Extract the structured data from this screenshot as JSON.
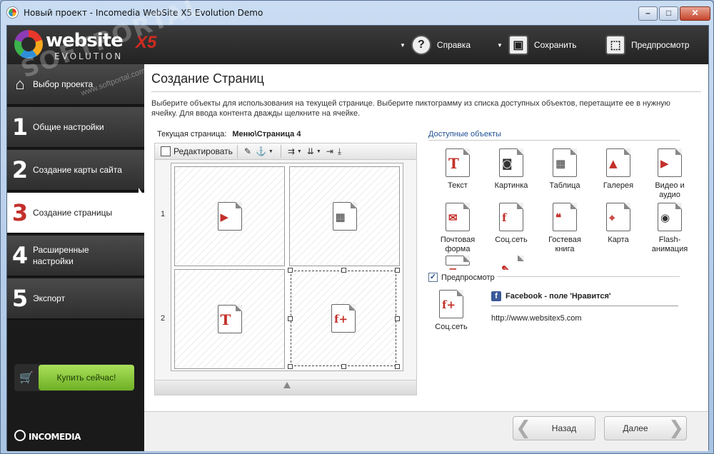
{
  "window": {
    "title": "Новый проект - Incomedia WebSite X5 Evolution Demo",
    "min": "–",
    "max": "□",
    "close": "✕"
  },
  "logo": {
    "word": "website",
    "x5": "X5",
    "sub": "EVOLUTION"
  },
  "watermark": {
    "main": "SOFTPORTAL",
    "sub": "www.softportal.com"
  },
  "header": {
    "help": "Справка",
    "save": "Сохранить",
    "preview": "Предпросмотр"
  },
  "sidebar": {
    "items": [
      {
        "num": "",
        "label": "Выбор проекта"
      },
      {
        "num": "1",
        "label": "Общие настройки"
      },
      {
        "num": "2",
        "label": "Создание карты сайта"
      },
      {
        "num": "3",
        "label": "Создание страницы"
      },
      {
        "num": "4",
        "label": "Расширенные настройки"
      },
      {
        "num": "5",
        "label": "Экспорт"
      }
    ],
    "buy": "Купить сейчас!",
    "brand": "INCOMEDIA"
  },
  "main": {
    "title": "Создание Страниц",
    "intro": "Выберите объекты для использования на текущей странице. Выберите пиктограмму из списка доступных объектов, перетащите ее в нужную ячейку. Для ввода контента дважды щелкните на ячейке.",
    "current_page_label": "Текущая страница:",
    "current_page_value": "Меню\\Страница 4",
    "toolbar": {
      "edit": "Редактировать"
    },
    "rows": [
      "1",
      "2"
    ]
  },
  "available": {
    "title": "Доступные объекты",
    "objects": [
      {
        "label": "Текст",
        "icon": "text-icon",
        "glyph": "T"
      },
      {
        "label": "Картинка",
        "icon": "image-icon",
        "glyph": "◙"
      },
      {
        "label": "Таблица",
        "icon": "table-icon",
        "glyph": "▦"
      },
      {
        "label": "Галерея",
        "icon": "gallery-icon",
        "glyph": "▲"
      },
      {
        "label": "Видео и аудио",
        "icon": "video-icon",
        "glyph": "▶"
      },
      {
        "label": "Почтовая форма",
        "icon": "mail-icon",
        "glyph": "✉"
      },
      {
        "label": "Соц.сеть",
        "icon": "social-icon",
        "glyph": "f"
      },
      {
        "label": "Гостевая книга",
        "icon": "guestbook-icon",
        "glyph": "❝"
      },
      {
        "label": "Карта",
        "icon": "map-icon",
        "glyph": "⌖"
      },
      {
        "label": "Flash-анимация",
        "icon": "flash-icon",
        "glyph": "◉"
      },
      {
        "label": "",
        "icon": "html-icon",
        "glyph": "≡"
      },
      {
        "label": "",
        "icon": "html-code-icon",
        "glyph": "✎"
      }
    ],
    "preview_label": "Предпросмотр",
    "preview_checked": "✓",
    "preview_object": "Соц.сеть",
    "fb_title": "Facebook - поле 'Нравится'",
    "fb_url": "http://www.websitex5.com"
  },
  "nav": {
    "back": "Назад",
    "next": "Далее",
    "back_chev": "❮",
    "next_chev": "❯"
  }
}
